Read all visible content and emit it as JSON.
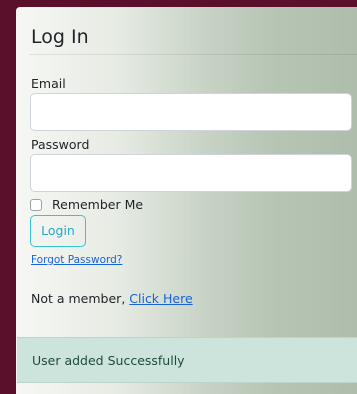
{
  "login_form": {
    "title": "Log In",
    "email_label": "Email",
    "email_value": "",
    "password_label": "Password",
    "password_value": "",
    "remember_label": "Remember Me",
    "remember_checked": false,
    "login_button": "Login",
    "forgot_password_link": "Forgot Password?",
    "member_prompt": "Not a member, ",
    "member_link": "Click Here"
  },
  "alert": {
    "message": "User added Successfully",
    "type": "success"
  },
  "colors": {
    "background": "#5a0f2a",
    "link": "#1a63d6",
    "button_outline": "#37c2d7",
    "alert_background": "#cde4dc"
  }
}
